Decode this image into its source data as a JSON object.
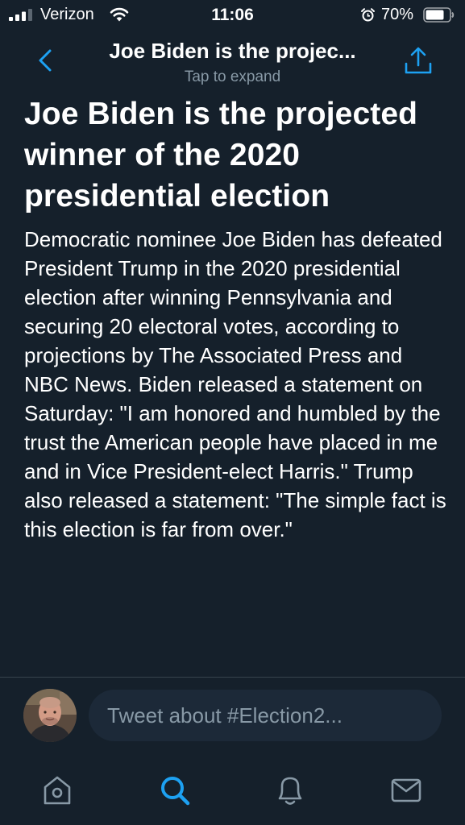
{
  "status_bar": {
    "carrier": "Verizon",
    "time": "11:06",
    "battery_percent": "70%",
    "icons": [
      "signal-icon",
      "wifi-icon",
      "alarm-icon",
      "battery-icon"
    ]
  },
  "header": {
    "title": "Joe Biden is the projec...",
    "subtitle": "Tap to expand",
    "back_icon": "chevron-left-icon",
    "share_icon": "share-icon"
  },
  "article": {
    "title": "Joe Biden is the projected winner of the 2020 presidential election",
    "body": "Democratic nominee Joe Biden has defeated President Trump in the 2020 presidential election after winning Pennsylvania and securing 20 electoral votes, according to projections by The Associated Press and NBC News. Biden released a statement on Saturday: \"I am honored and humbled by the trust the American people have placed in me and in Vice President-elect Harris.\" Trump also released a statement: \"The simple fact is this election is far from over.\""
  },
  "compose": {
    "placeholder": "Tweet about #Election2..."
  },
  "tab_bar": {
    "tabs": [
      "home-icon",
      "search-icon",
      "notifications-icon",
      "messages-icon"
    ],
    "active": "search-icon"
  },
  "colors": {
    "background": "#15202b",
    "accent": "#1da1f2",
    "secondary_text": "#8899a6",
    "input_background": "#1c2938"
  }
}
